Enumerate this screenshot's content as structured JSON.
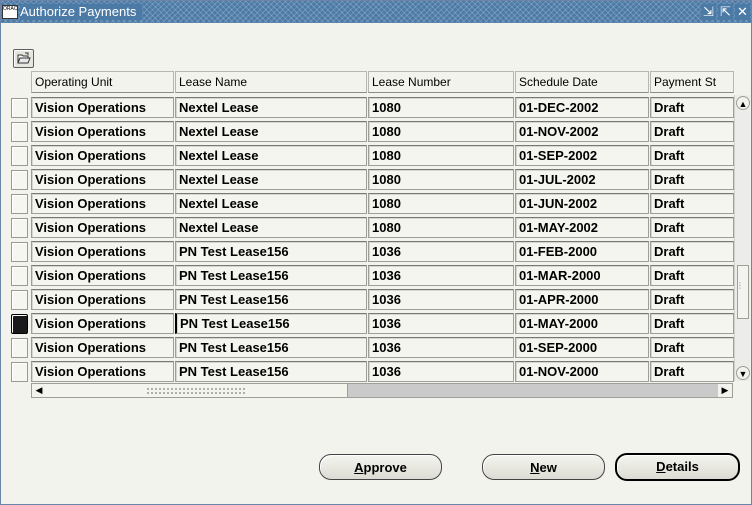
{
  "window": {
    "title": "Authorize Payments",
    "app_icon_text": "ORACLE",
    "controls": {
      "minimize": "⇲",
      "maximize": "⇱",
      "close": "✕"
    }
  },
  "toolbar": {
    "folder_icon": "folder-open-icon"
  },
  "table": {
    "columns": [
      "Operating Unit",
      "Lease Name",
      "Lease Number",
      "Schedule Date",
      "Payment St"
    ],
    "rows": [
      [
        "Vision Operations",
        "Nextel Lease",
        "1080",
        "01-DEC-2002",
        "Draft"
      ],
      [
        "Vision Operations",
        "Nextel Lease",
        "1080",
        "01-NOV-2002",
        "Draft"
      ],
      [
        "Vision Operations",
        "Nextel Lease",
        "1080",
        "01-SEP-2002",
        "Draft"
      ],
      [
        "Vision Operations",
        "Nextel Lease",
        "1080",
        "01-JUL-2002",
        "Draft"
      ],
      [
        "Vision Operations",
        "Nextel Lease",
        "1080",
        "01-JUN-2002",
        "Draft"
      ],
      [
        "Vision Operations",
        "Nextel Lease",
        "1080",
        "01-MAY-2002",
        "Draft"
      ],
      [
        "Vision Operations",
        "PN Test Lease156",
        "1036",
        "01-FEB-2000",
        "Draft"
      ],
      [
        "Vision Operations",
        "PN Test Lease156",
        "1036",
        "01-MAR-2000",
        "Draft"
      ],
      [
        "Vision Operations",
        "PN Test Lease156",
        "1036",
        "01-APR-2000",
        "Draft"
      ],
      [
        "Vision Operations",
        "PN Test Lease156",
        "1036",
        "01-MAY-2000",
        "Draft"
      ],
      [
        "Vision Operations",
        "PN Test Lease156",
        "1036",
        "01-SEP-2000",
        "Draft"
      ],
      [
        "Vision Operations",
        "PN Test Lease156",
        "1036",
        "01-NOV-2000",
        "Draft"
      ]
    ],
    "selected_row": 9
  },
  "scroll": {
    "up": "▲",
    "down": "▼",
    "left": "◀",
    "right": "▶"
  },
  "buttons": {
    "approve": {
      "mnemonic": "A",
      "rest": "pprove"
    },
    "new": {
      "mnemonic": "N",
      "rest": "ew"
    },
    "details": {
      "mnemonic": "D",
      "rest": "etails"
    }
  }
}
